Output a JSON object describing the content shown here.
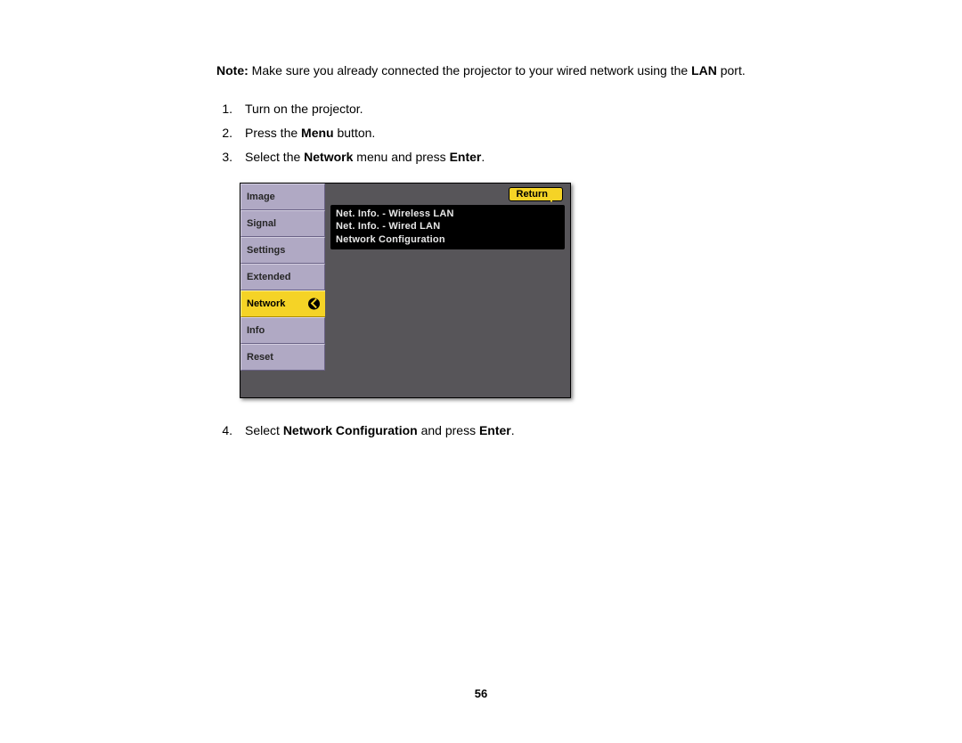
{
  "note": {
    "label": "Note:",
    "text_1": " Make sure you already connected the projector to your wired network using the ",
    "bold_1": "LAN",
    "text_2": " port."
  },
  "steps_a": [
    {
      "n": "1.",
      "pre": "",
      "b1": "",
      "mid": "Turn on the projector.",
      "b2": "",
      "post": ""
    },
    {
      "n": "2.",
      "pre": "Press the ",
      "b1": "Menu",
      "mid": " button.",
      "b2": "",
      "post": ""
    },
    {
      "n": "3.",
      "pre": "Select the ",
      "b1": "Network",
      "mid": " menu and press ",
      "b2": "Enter",
      "post": "."
    }
  ],
  "steps_b": [
    {
      "n": "4.",
      "pre": "Select ",
      "b1": "Network Configuration",
      "mid": " and press ",
      "b2": "Enter",
      "post": "."
    }
  ],
  "menu": {
    "sidebar": [
      "Image",
      "Signal",
      "Settings",
      "Extended",
      "Network",
      "Info",
      "Reset"
    ],
    "selected_index": 4,
    "return_label": "Return",
    "panel_items": [
      "Net. Info. - Wireless LAN",
      "Net. Info. - Wired LAN",
      "Network Configuration"
    ]
  },
  "page_number": "56"
}
